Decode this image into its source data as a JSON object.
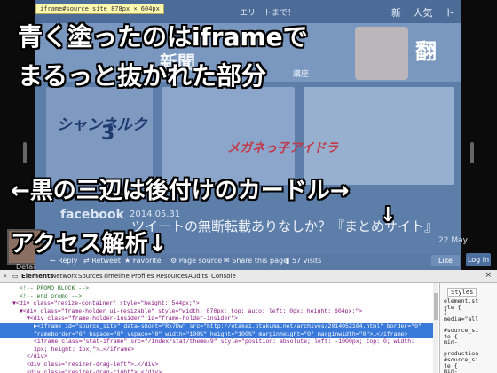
{
  "overlay": {
    "line1": "青く塗ったのはiframeで",
    "line2": "まるっと抜かれた部分",
    "line3": "←黒の三辺は後付けのカードル→",
    "line4": "↓",
    "line5": "アクセス解析↓"
  },
  "inspector_tip": "iframe#source_site 878px × 604px",
  "site": {
    "tagline": "エリートまで！",
    "nav": [
      "新",
      "人気",
      "ト"
    ],
    "banner_word": "翻",
    "banner_new": "新聞",
    "banner_sub": "講座",
    "thumb1_title": "シャンネルク",
    "thumb1_num": "3",
    "thumb2_title": "メガネっ子アイドラ",
    "date": "2014.05.31",
    "article_text": "ツイートの無断転載ありなしか？『まとめサイト』",
    "facebook": "facebook",
    "may": "22 May",
    "details": "Detail"
  },
  "tweet_bar": {
    "reply": "Reply",
    "retweet": "Retweet",
    "favorite": "Favorite",
    "page_source": "Page source",
    "share": "Share this page",
    "visits": "57 visits",
    "like": "Like",
    "login": "Log in"
  },
  "devtools": {
    "tabs": [
      "Elements",
      "Network",
      "Sources",
      "Timeline",
      "Profiles",
      "Resources",
      "Audits",
      "Console"
    ],
    "close": "×",
    "styles_tab": "Styles",
    "code_lines": [
      {
        "indent": 2,
        "text": "<!-- PROMO BLOCK -->",
        "kind": "comment",
        "selected": false
      },
      {
        "indent": 2,
        "text": "<!-- end promo -->",
        "kind": "comment",
        "selected": false
      },
      {
        "indent": 1,
        "text": "▼<div class=\"resize-container\" style=\"height: 544px;\">",
        "kind": "tag",
        "selected": false
      },
      {
        "indent": 2,
        "text": "▼<div class=\"frame-holder ui-resizable\" style=\"width: 878px; top: auto; left: 0px; height: 604px;\">",
        "kind": "tag",
        "selected": false
      },
      {
        "indent": 3,
        "text": "▼<div class=\"frame-holder-insider\" id=\"frame-holder-insider\">",
        "kind": "tag",
        "selected": false
      },
      {
        "indent": 4,
        "text": "►<iframe id=\"source_site\" data-short=\"Rx7Dw\" src=\"http://otakei.otakuma.net/archives/2014052104.html\" border=\"0\"",
        "kind": "tag",
        "selected": true
      },
      {
        "indent": 4,
        "text": "frameborder=\"0\" hspace=\"0\" vspace=\"0\" width=\"100%\" height=\"100%\" marginheight=\"0\" marginwidth=\"0\">…</iframe>",
        "kind": "tag",
        "selected": true
      },
      {
        "indent": 4,
        "text": "<iframe class=\"stat-iframe\" src=\"/index/stat/theme/9\" style=\"position: absolute; left: -1000px; top: 0; width:",
        "kind": "tag",
        "selected": false
      },
      {
        "indent": 4,
        "text": "1px; height: 1px;\">…</iframe>",
        "kind": "tag",
        "selected": false
      },
      {
        "indent": 3,
        "text": "</div>",
        "kind": "tag",
        "selected": false
      },
      {
        "indent": 3,
        "text": "<div class=\"resizer-drag-left\">…</div>",
        "kind": "tag",
        "selected": false
      },
      {
        "indent": 3,
        "text": "<div class=\"resizer-drag-right\">…</div>",
        "kind": "tag",
        "selected": false
      }
    ],
    "styles_lines": [
      "element.st",
      "yle {",
      "}",
      "media=\"all",
      "",
      "#source_si",
      "te {",
      "  min-",
      "",
      "production",
      "#source_si",
      "te {",
      "  min-"
    ]
  }
}
